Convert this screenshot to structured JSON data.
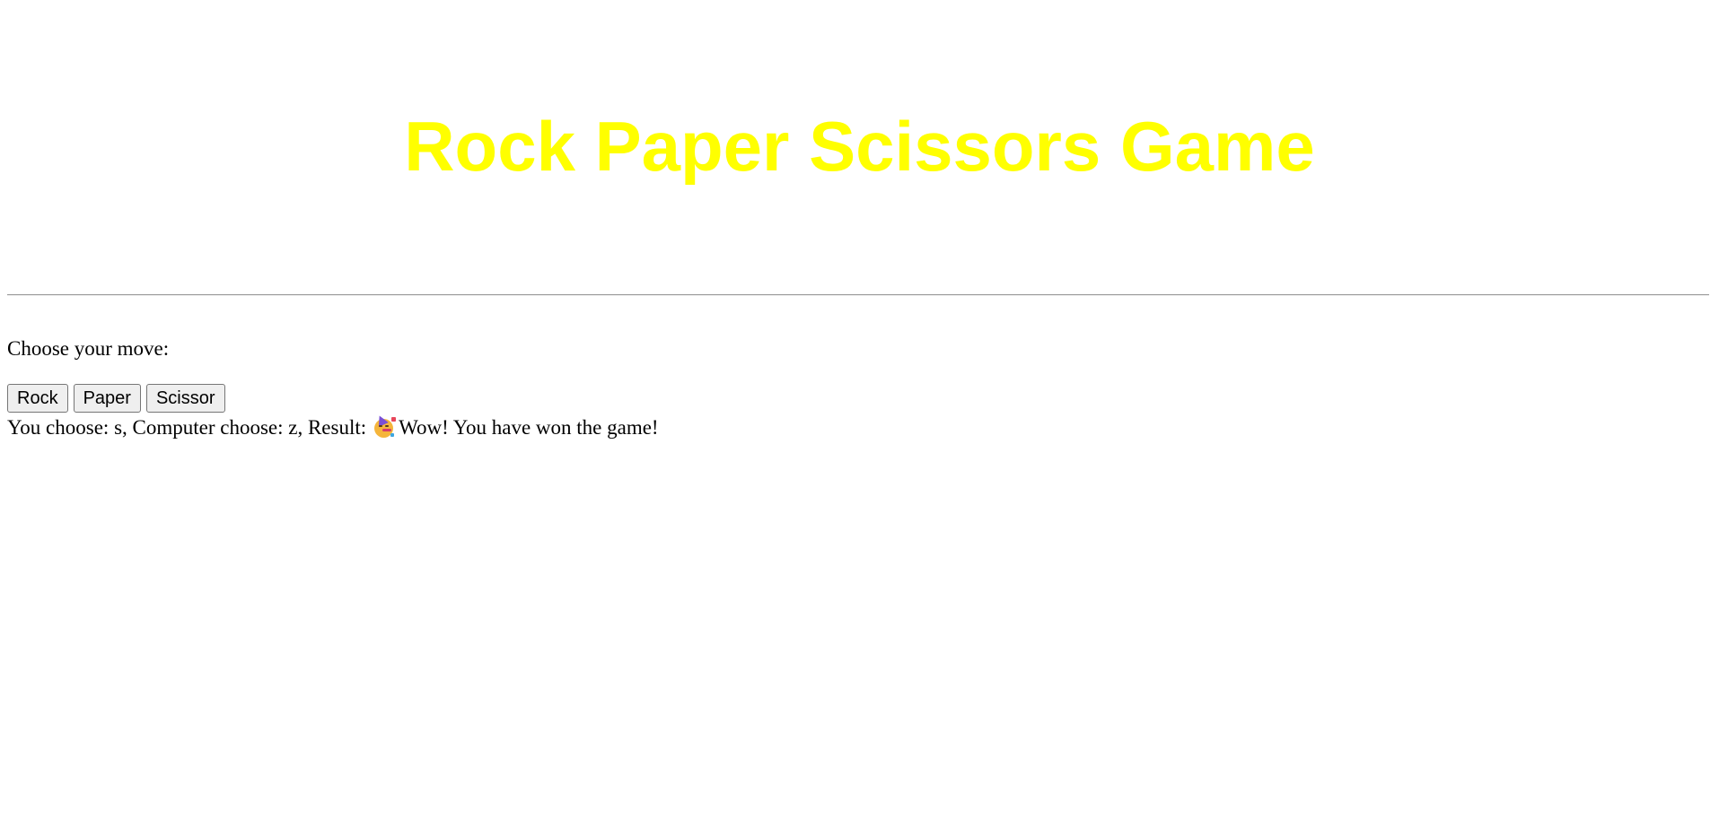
{
  "page": {
    "title": "Rock Paper Scissors Game",
    "title_color": "#ffff00"
  },
  "game": {
    "prompt": "Choose your move:",
    "buttons": {
      "rock": "Rock",
      "paper": "Paper",
      "scissor": "Scissor"
    },
    "result": {
      "user_label": "You choose: s, Computer choose: z, Result:",
      "emoji_icon": "partying-face-icon",
      "message": "Wow! You have won the game!"
    }
  }
}
